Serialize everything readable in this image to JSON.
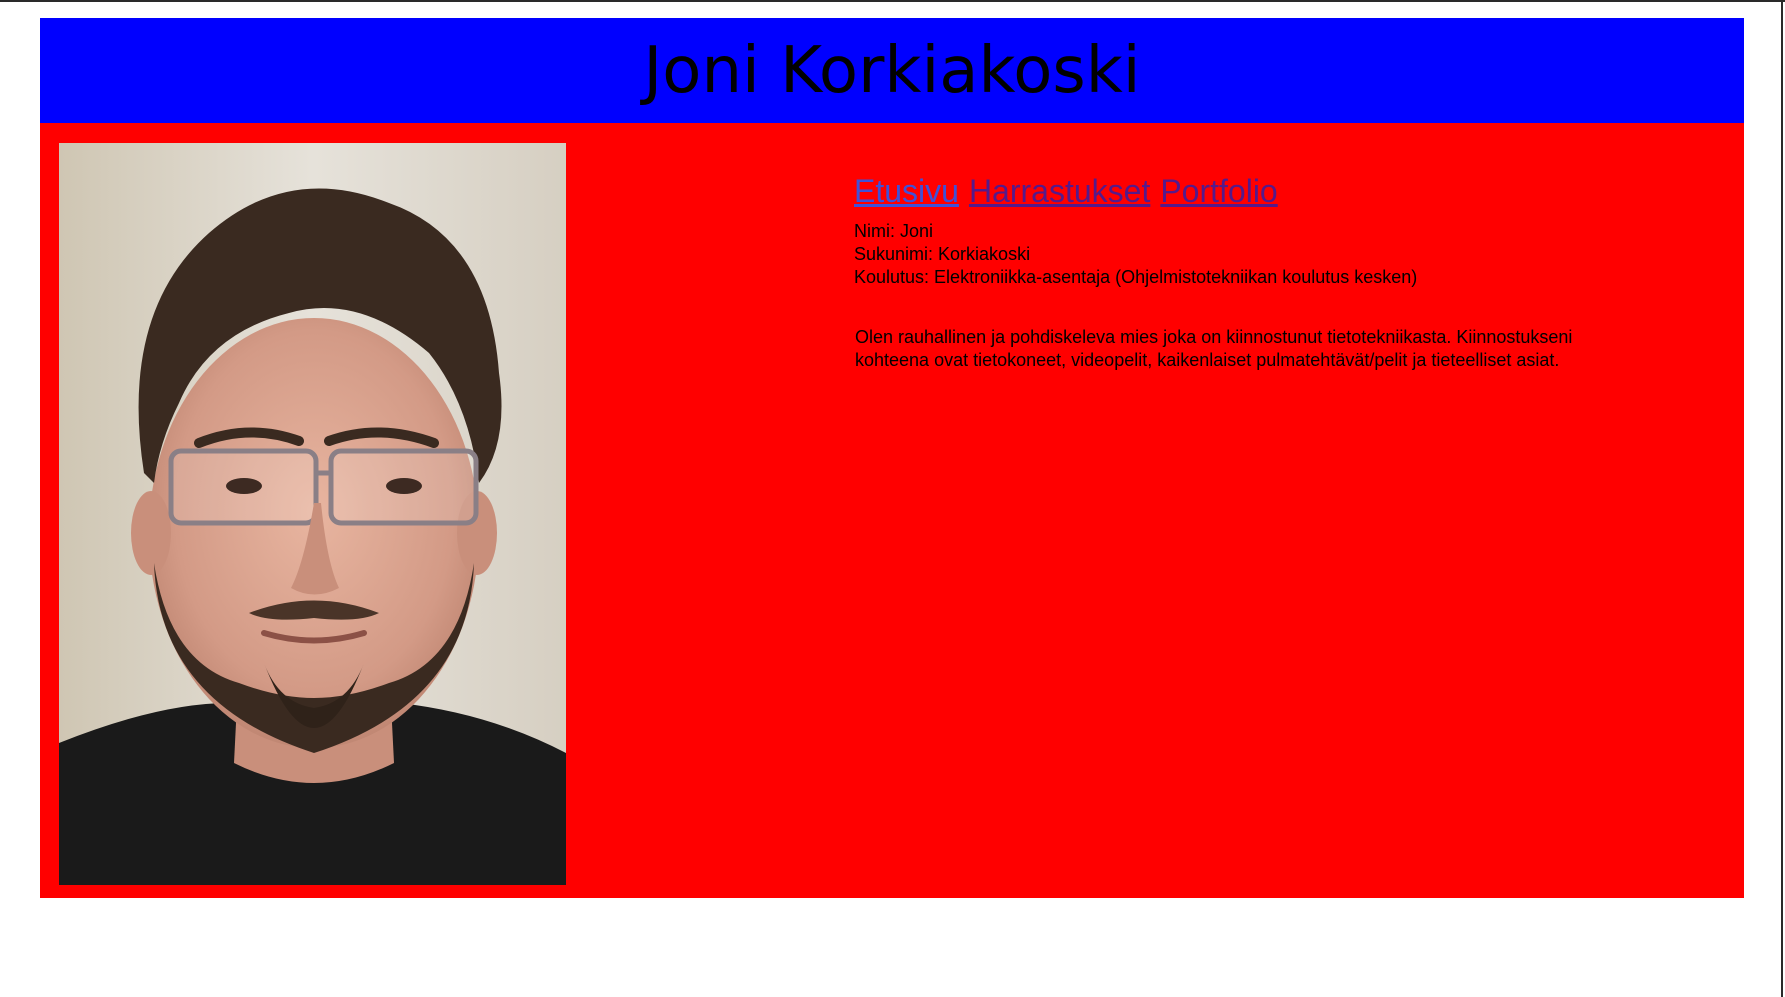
{
  "header": {
    "title": "Joni Korkiakoski"
  },
  "colors": {
    "header_bg": "#0000ff",
    "content_bg": "#ff0000",
    "link_visited": "#551a8b",
    "link_active": "#3f51d8"
  },
  "nav": {
    "items": [
      {
        "label": "Etusivu",
        "icon": "none"
      },
      {
        "label": "Harrastukset",
        "icon": "none"
      },
      {
        "label": "Portfolio",
        "icon": "none"
      }
    ]
  },
  "profile": {
    "photo_name": "profile-photo",
    "fields": [
      {
        "text": "Nimi: Joni"
      },
      {
        "text": "Sukunimi: Korkiakoski"
      },
      {
        "text": "Koulutus: Elektroniikka-asentaja (Ohjelmistotekniikan koulutus kesken)"
      }
    ],
    "about": "Olen rauhallinen ja pohdiskeleva mies joka on kiinnostunut tietotekniikasta. Kiinnostukseni kohteena ovat tietokoneet, videopelit, kaikenlaiset pulmatehtävät/pelit ja tieteelliset asiat."
  }
}
